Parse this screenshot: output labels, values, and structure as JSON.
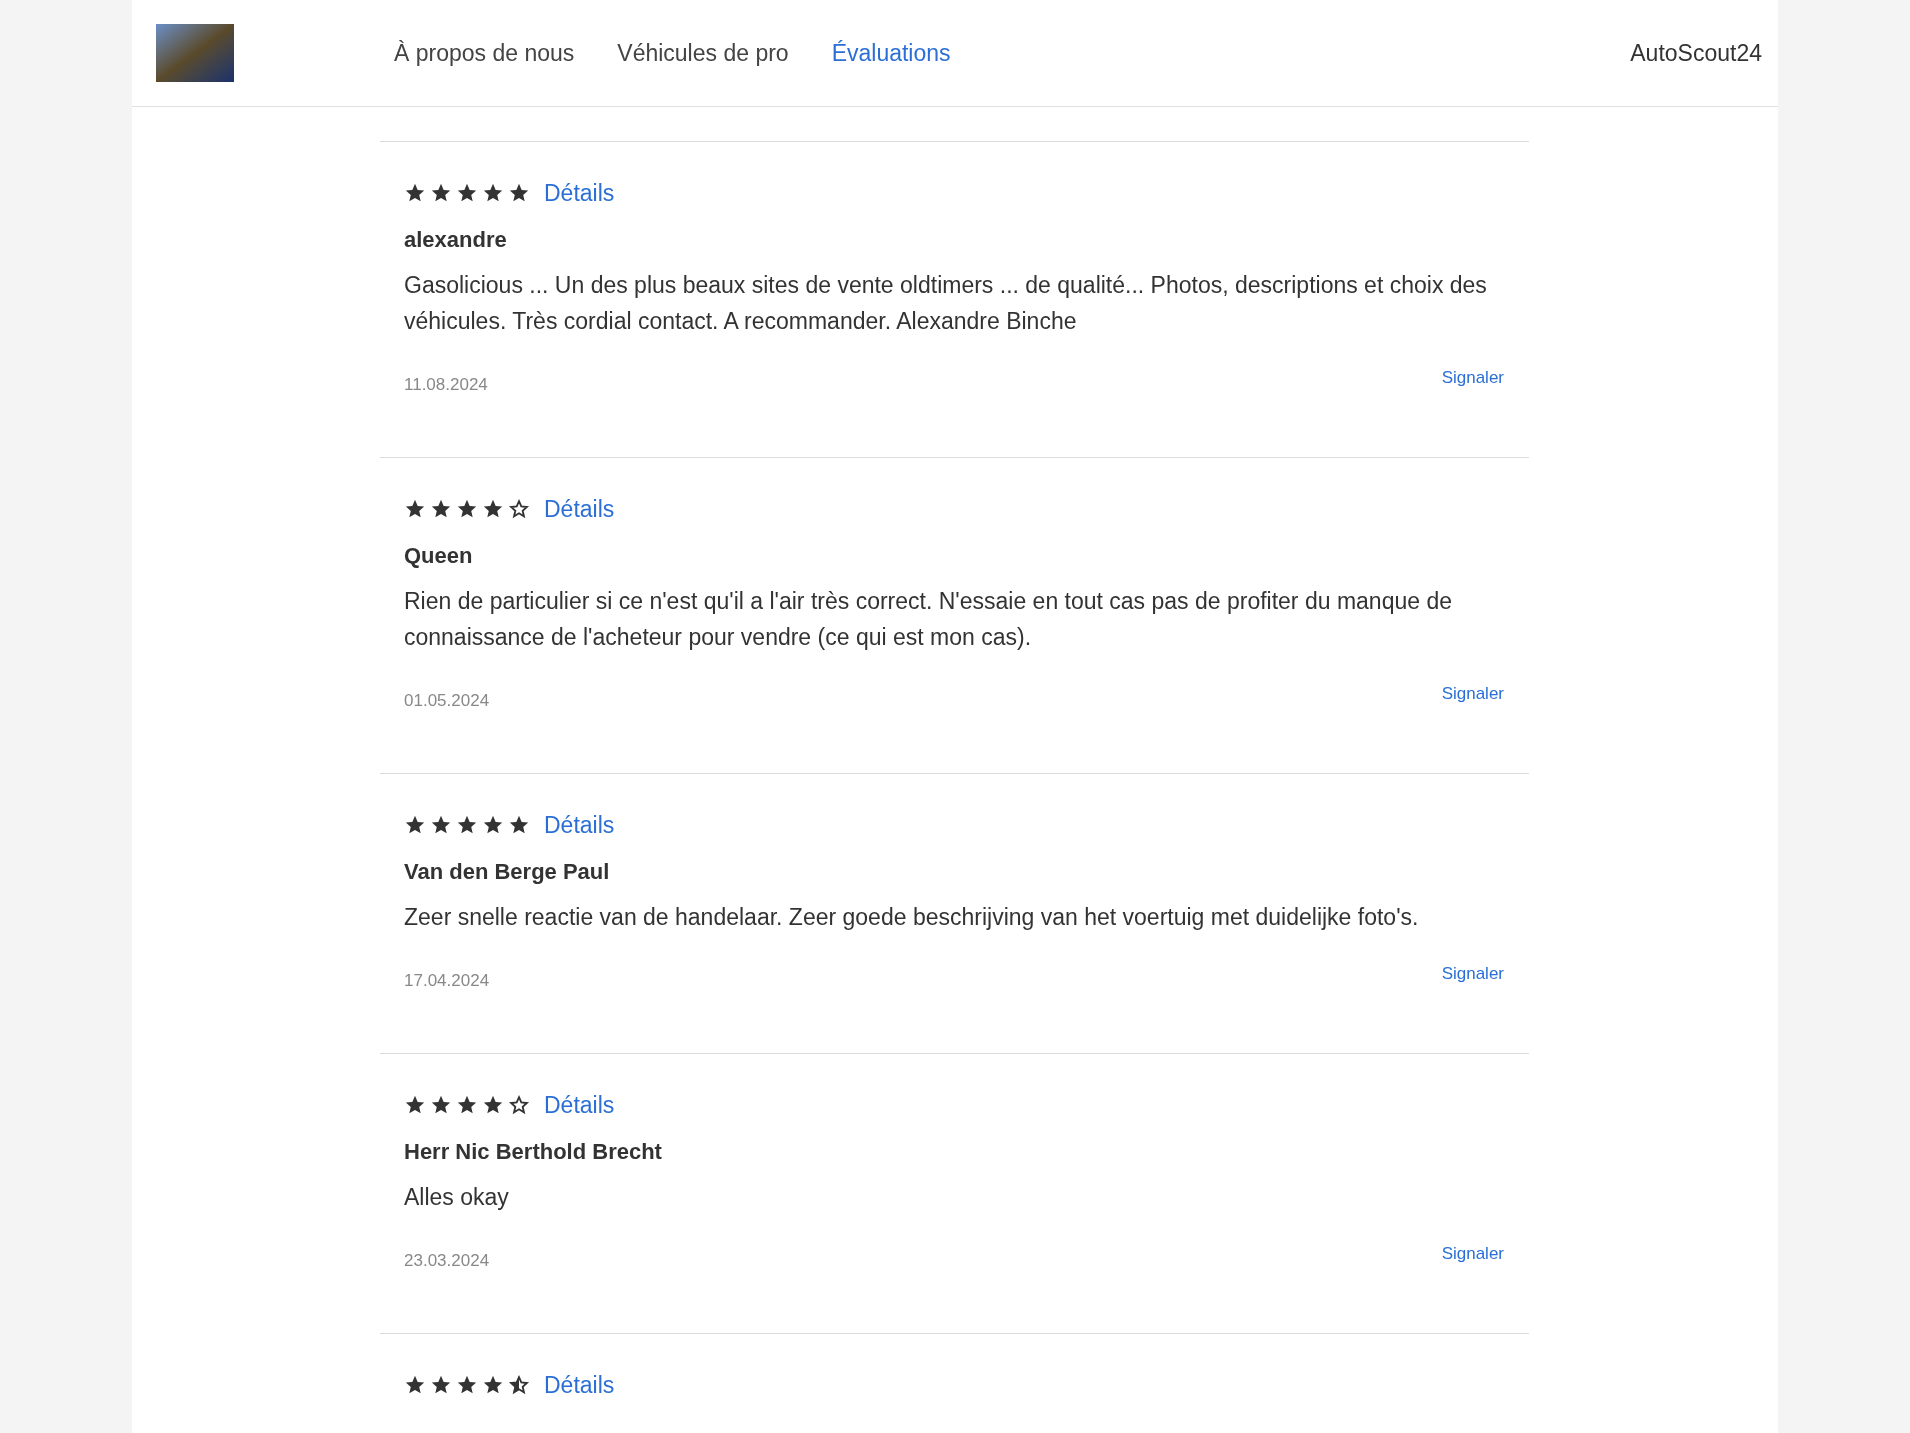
{
  "header": {
    "nav": [
      {
        "label": "À propos de nous",
        "selected": false
      },
      {
        "label": "Véhicules de pro",
        "selected": false
      },
      {
        "label": "Évaluations",
        "selected": true
      }
    ],
    "brand": "AutoScout24"
  },
  "reviews": [
    {
      "stars": 5,
      "details": "Détails",
      "author": "alexandre",
      "text": "Gasolicious ... Un des plus beaux sites de vente oldtimers ... de qualité... Photos, descriptions et choix des véhicules. Très cordial contact. A recommander. Alexandre Binche",
      "date": "11.08.2024",
      "report": "Signaler"
    },
    {
      "stars": 4,
      "details": "Détails",
      "author": "Queen",
      "text": "Rien de particulier si ce n'est qu'il a l'air très correct. N'essaie en tout cas pas de profiter du manque de connaissance de l'acheteur pour vendre (ce qui est mon cas).",
      "date": "01.05.2024",
      "report": "Signaler"
    },
    {
      "stars": 5,
      "details": "Détails",
      "author": "Van den Berge Paul",
      "text": "Zeer snelle reactie van de handelaar. Zeer goede beschrijving van het voertuig met duidelijke foto's.",
      "date": "17.04.2024",
      "report": "Signaler"
    },
    {
      "stars": 4,
      "details": "Détails",
      "author": "Herr Nic Berthold Brecht",
      "text": "Alles okay",
      "date": "23.03.2024",
      "report": "Signaler"
    },
    {
      "stars": 4.5,
      "details": "Détails"
    }
  ]
}
